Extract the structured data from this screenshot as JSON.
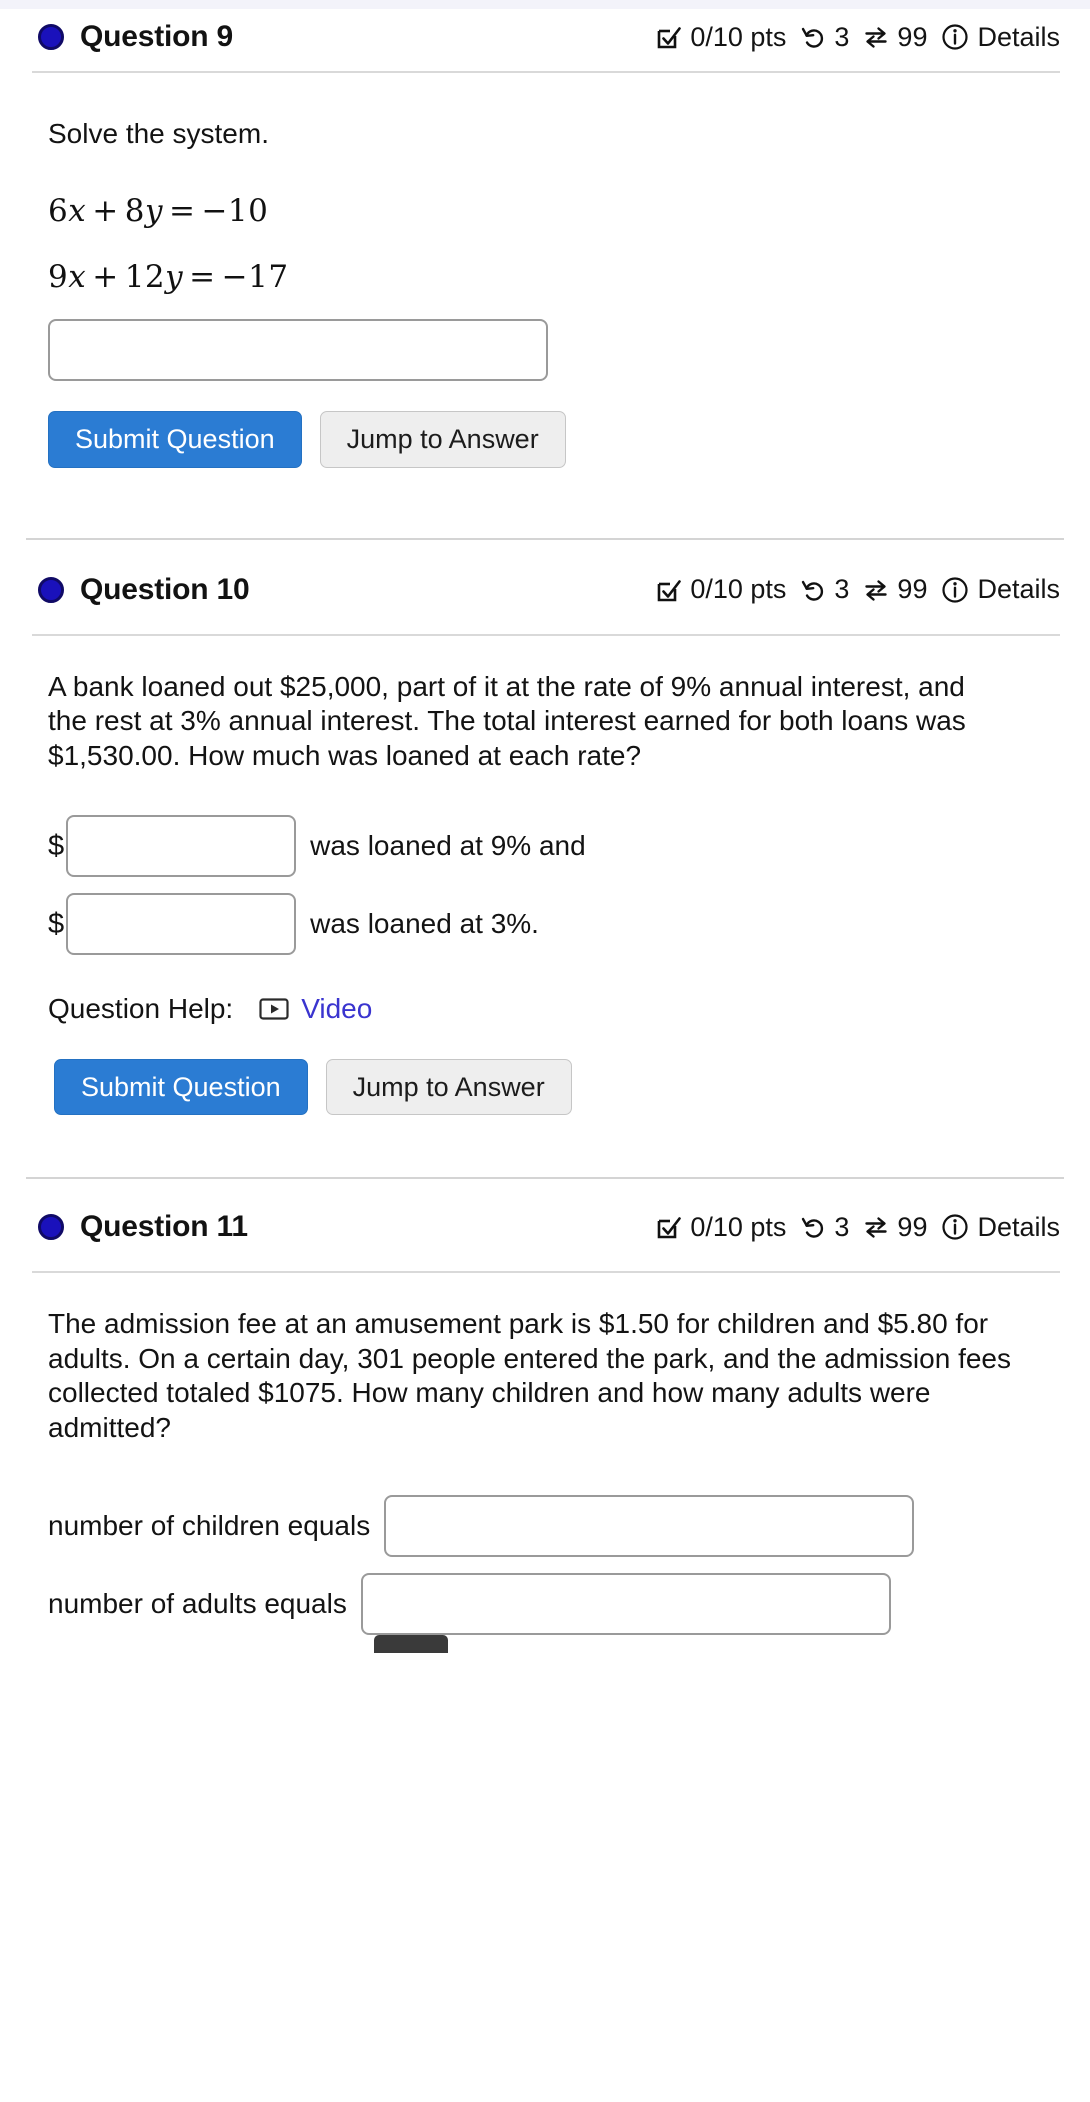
{
  "meta": {
    "accent_blue": "#2b7cd3",
    "dot_color": "#1a11bb",
    "link_color": "#3a34cf"
  },
  "questions": [
    {
      "id": "q9",
      "title": "Question 9",
      "points": "0/10 pts",
      "attempts": "3",
      "retries": "99",
      "details_label": "Details",
      "prompt": "Solve the system.",
      "equations": [
        {
          "lhs_a": "6",
          "var_a": "x",
          "op": "+",
          "lhs_b": "8",
          "var_b": "y",
          "eq": "=",
          "rhs": "−10"
        },
        {
          "lhs_a": "9",
          "var_a": "x",
          "op": "+",
          "lhs_b": "12",
          "var_b": "y",
          "eq": "=",
          "rhs": "−17"
        }
      ],
      "answer_placeholder": "",
      "answer_value": "",
      "submit_label": "Submit Question",
      "jump_label": "Jump to Answer"
    },
    {
      "id": "q10",
      "title": "Question 10",
      "points": "0/10 pts",
      "attempts": "3",
      "retries": "99",
      "details_label": "Details",
      "prompt": "A bank loaned out $25,000, part of it at the rate of 9% annual interest, and the rest at 3% annual interest. The total interest earned for both loans was $1,530.00. How much was loaned at each rate?",
      "fields": [
        {
          "prefix": "$",
          "value": "",
          "placeholder": "",
          "suffix": "was loaned at 9% and"
        },
        {
          "prefix": "$",
          "value": "",
          "placeholder": "",
          "suffix": "was loaned at 3%."
        }
      ],
      "help_label": "Question Help:",
      "help_link": "Video",
      "submit_label": "Submit Question",
      "jump_label": "Jump to Answer"
    },
    {
      "id": "q11",
      "title": "Question 11",
      "points": "0/10 pts",
      "attempts": "3",
      "retries": "99",
      "details_label": "Details",
      "prompt": "The admission fee at an amusement park is $1.50 for children and $5.80 for adults. On a certain day, 301 people entered the park, and the admission fees collected totaled $1075. How many children and how many adults were admitted?",
      "fields": [
        {
          "label": "number of children equals",
          "value": "",
          "placeholder": ""
        },
        {
          "label": "number of adults equals",
          "value": "",
          "placeholder": ""
        }
      ]
    }
  ]
}
